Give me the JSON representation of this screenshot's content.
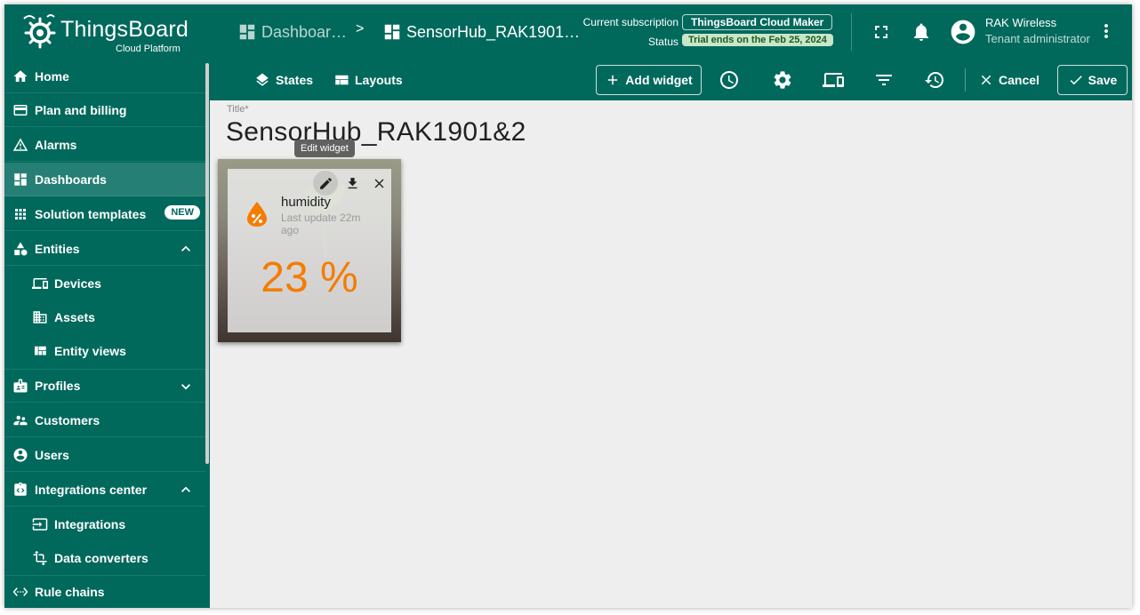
{
  "header": {
    "logo_name": "ThingsBoard",
    "logo_sub": "Cloud Platform",
    "breadcrumb_dashboards": "Dashboar…",
    "breadcrumb_sep": ">",
    "breadcrumb_current": "SensorHub_RAK1901…",
    "subscription_label": "Current subscription",
    "subscription_plan": "ThingsBoard Cloud Maker",
    "status_label": "Status",
    "status_text": "Trial ends on the Feb 25, 2024",
    "user_name": "RAK Wireless",
    "user_role": "Tenant administrator"
  },
  "sidebar": {
    "items": [
      {
        "label": "Home",
        "icon": "home-icon"
      },
      {
        "label": "Plan and billing",
        "icon": "credit-card-icon"
      },
      {
        "label": "Alarms",
        "icon": "warning-icon"
      },
      {
        "label": "Dashboards",
        "icon": "dashboard-icon",
        "active": true
      },
      {
        "label": "Solution templates",
        "icon": "apps-grid-icon",
        "badge": "NEW"
      },
      {
        "label": "Entities",
        "icon": "category-icon",
        "expanded": true
      },
      {
        "label": "Devices",
        "icon": "devices-icon"
      },
      {
        "label": "Assets",
        "icon": "domain-icon"
      },
      {
        "label": "Entity views",
        "icon": "view-quilt-icon"
      },
      {
        "label": "Profiles",
        "icon": "badge-icon",
        "expanded": false
      },
      {
        "label": "Customers",
        "icon": "supervisor-icon"
      },
      {
        "label": "Users",
        "icon": "account-circle-icon"
      },
      {
        "label": "Integrations center",
        "icon": "integration-icon",
        "expanded": true
      },
      {
        "label": "Integrations",
        "icon": "input-icon"
      },
      {
        "label": "Data converters",
        "icon": "transform-icon"
      },
      {
        "label": "Rule chains",
        "icon": "settings-ethernet-icon"
      }
    ]
  },
  "toolbar": {
    "states": "States",
    "layouts": "Layouts",
    "add_widget": "Add widget",
    "cancel": "Cancel",
    "save": "Save"
  },
  "content": {
    "title_label": "Title*",
    "dashboard_title": "SensorHub_RAK1901&2"
  },
  "widget": {
    "tooltip": "Edit widget",
    "title": "humidity",
    "subtitle": "Last update 22m ago",
    "value": "23 %"
  },
  "colors": {
    "primary": "#00695c",
    "accent_value": "#f57c00",
    "trial_chip_bg": "#c8e6c9"
  }
}
